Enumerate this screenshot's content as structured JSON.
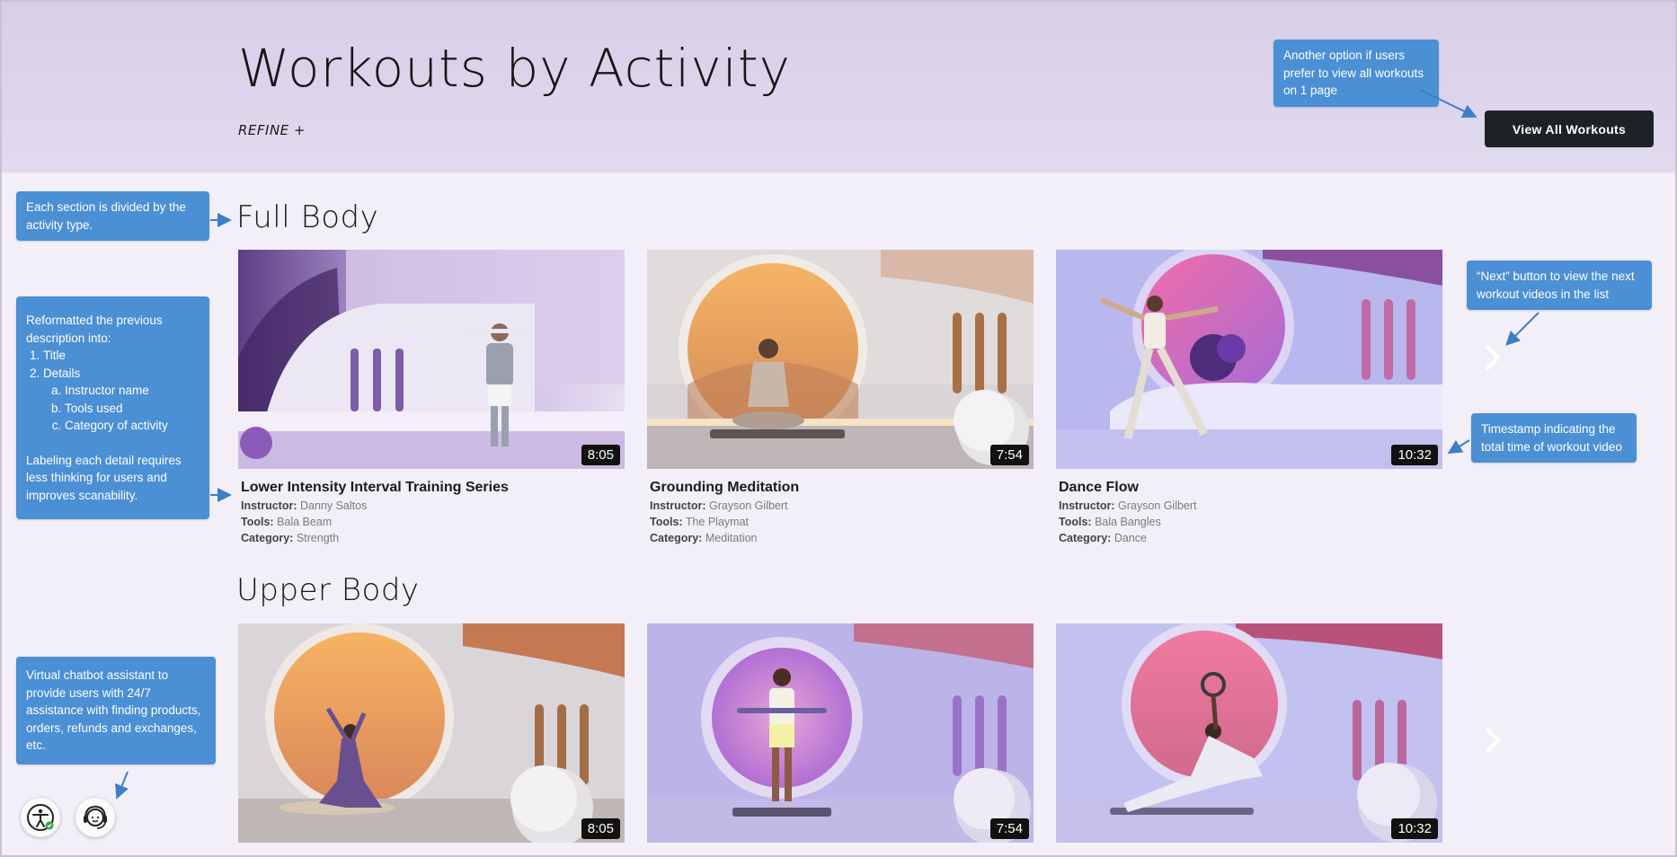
{
  "header": {
    "title": "Workouts by Activity",
    "refine_label": "REFINE +",
    "view_all_label": "View  All Workouts"
  },
  "sections": [
    {
      "title": "Full Body",
      "cards": [
        {
          "title": "Lower Intensity Interval Training Series",
          "duration": "8:05",
          "instructor_label": "Instructor:",
          "instructor": "Danny Saltos",
          "tools_label": "Tools:",
          "tools": "Bala Beam",
          "category_label": "Category:",
          "category": "Strength"
        },
        {
          "title": "Grounding Meditation",
          "duration": "7:54",
          "instructor_label": "Instructor:",
          "instructor": "Grayson Gilbert",
          "tools_label": "Tools:",
          "tools": "The Playmat",
          "category_label": "Category:",
          "category": "Meditation"
        },
        {
          "title": "Dance Flow",
          "duration": "10:32",
          "instructor_label": "Instructor:",
          "instructor": "Grayson Gilbert",
          "tools_label": "Tools:",
          "tools": "Bala Bangles",
          "category_label": "Category:",
          "category": "Dance"
        }
      ]
    },
    {
      "title": "Upper Body",
      "cards": [
        {
          "duration": "8:05"
        },
        {
          "duration": "7:54"
        },
        {
          "duration": "10:32"
        }
      ]
    }
  ],
  "annotations": {
    "view_all": "Another option if users prefer to view all workouts on 1 page",
    "section": "Each section is divided by the activity type.",
    "reformat_intro": "Reformatted the previous description into:",
    "reformat_items": [
      "Title",
      "Details"
    ],
    "reformat_subitems": [
      "Instructor name",
      "Tools used",
      "Category of activity"
    ],
    "reformat_outro": "Labeling each detail requires less thinking for users and improves scanability.",
    "next": "“Next” button to view the next workout videos in the list",
    "timestamp": "Timestamp indicating the total time of workout video",
    "chatbot": "Virtual chatbot assistant to provide users with 24/7 assistance with finding products, orders, refunds and exchanges, etc."
  },
  "icons": {
    "next": "chevron-right-icon",
    "accessibility": "accessibility-icon",
    "chat": "headset-chat-icon"
  },
  "colors": {
    "header_bg": "#d7cee8",
    "annotation": "#4b8fd4",
    "button_dark": "#1f2225"
  }
}
